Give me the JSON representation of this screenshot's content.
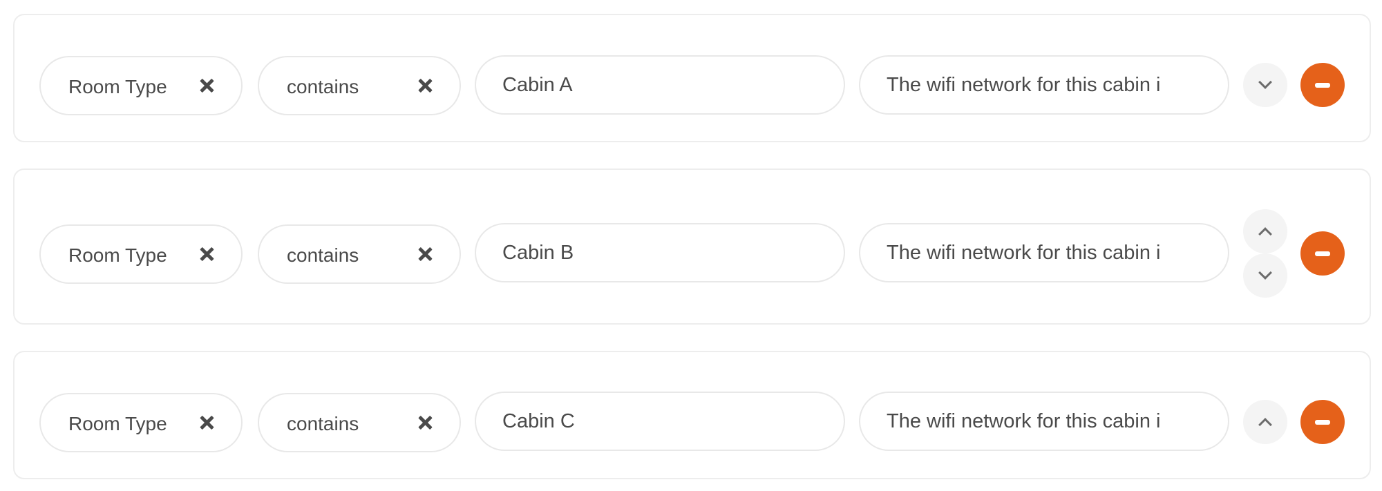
{
  "theme": {
    "accent": "#E5611A",
    "border": "#EDEDED",
    "move_button_bg": "#F4F4F4",
    "text": "#4A4A4A"
  },
  "rules": [
    {
      "field_chip": {
        "label": "Room Type",
        "clear_icon": "x-icon"
      },
      "operator_chip": {
        "label": "contains",
        "clear_icon": "x-icon"
      },
      "match_value": "Cabin A",
      "response_value": "The wifi network for this cabin i",
      "move_up": false,
      "move_down": true,
      "remove_icon": "minus-circle-icon"
    },
    {
      "field_chip": {
        "label": "Room Type",
        "clear_icon": "x-icon"
      },
      "operator_chip": {
        "label": "contains",
        "clear_icon": "x-icon"
      },
      "match_value": "Cabin B",
      "response_value": "The wifi network for this cabin i",
      "move_up": true,
      "move_down": true,
      "remove_icon": "minus-circle-icon"
    },
    {
      "field_chip": {
        "label": "Room Type",
        "clear_icon": "x-icon"
      },
      "operator_chip": {
        "label": "contains",
        "clear_icon": "x-icon"
      },
      "match_value": "Cabin C",
      "response_value": "The wifi network for this cabin i",
      "move_up": true,
      "move_down": false,
      "remove_icon": "minus-circle-icon"
    }
  ]
}
